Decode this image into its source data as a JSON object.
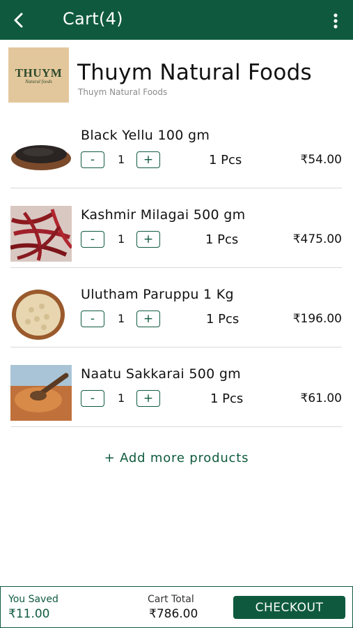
{
  "header": {
    "title": "Cart(4)",
    "back_icon": "arrow-left",
    "menu_icon": "more-vertical"
  },
  "store": {
    "logo_text": "THUYM",
    "logo_sub": "Natural foods",
    "name": "Thuym Natural Foods",
    "subtitle": "Thuym Natural Foods"
  },
  "items": [
    {
      "name": "Black Yellu 100 gm",
      "qty": "1",
      "unit": "1 Pcs",
      "price": "₹54.00",
      "minus": "-",
      "plus": "+"
    },
    {
      "name": "Kashmir Milagai  500 gm",
      "qty": "1",
      "unit": "1 Pcs",
      "price": "₹475.00",
      "minus": "-",
      "plus": "+"
    },
    {
      "name": "Ulutham Paruppu 1 Kg",
      "qty": "1",
      "unit": "1 Pcs",
      "price": "₹196.00",
      "minus": "-",
      "plus": "+"
    },
    {
      "name": "Naatu Sakkarai 500 gm",
      "qty": "1",
      "unit": "1 Pcs",
      "price": "₹61.00",
      "minus": "-",
      "plus": "+"
    }
  ],
  "add_more": "+ Add more products",
  "footer": {
    "saved_label": "You Saved",
    "saved_value": "₹11.00",
    "total_label": "Cart Total",
    "total_value": "₹786.00",
    "checkout_label": "CHECKOUT"
  },
  "colors": {
    "primary": "#0f5a3e"
  }
}
